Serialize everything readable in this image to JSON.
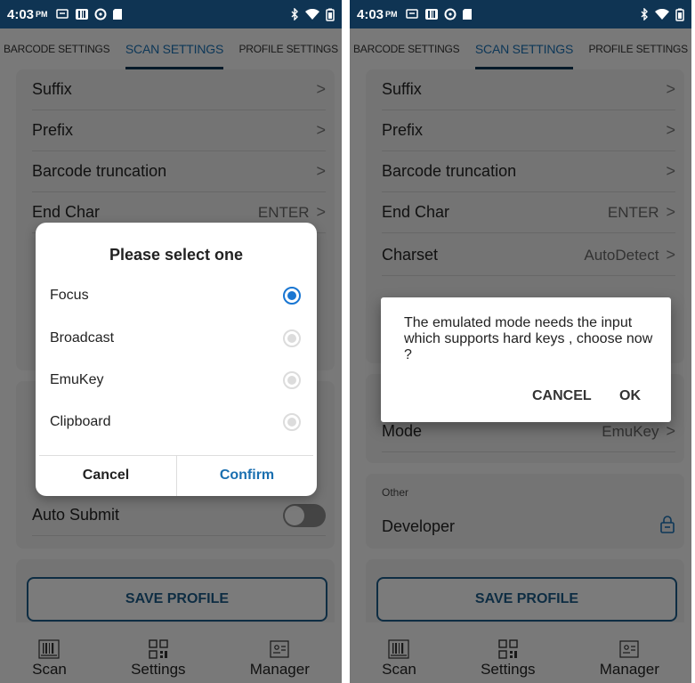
{
  "status": {
    "time": "4:03",
    "ampm": "PM"
  },
  "tabs": [
    "BARCODE SETTINGS",
    "SCAN SETTINGS",
    "PROFILE SETTINGS"
  ],
  "left": {
    "rows": [
      {
        "label": "Suffix",
        "value": "",
        "chevron": true
      },
      {
        "label": "Prefix",
        "value": "",
        "chevron": true
      },
      {
        "label": "Barcode truncation",
        "value": "",
        "chevron": true
      },
      {
        "label": "End Char",
        "value": "ENTER",
        "chevron": true
      }
    ],
    "auto_submit_label": "Auto Submit",
    "save_label": "SAVE PROFILE",
    "dialog": {
      "title": "Please select one",
      "options": [
        "Focus",
        "Broadcast",
        "EmuKey",
        "Clipboard"
      ],
      "selected": "Focus",
      "cancel": "Cancel",
      "confirm": "Confirm"
    }
  },
  "right": {
    "rows": [
      {
        "label": "Suffix",
        "value": "",
        "chevron": true
      },
      {
        "label": "Prefix",
        "value": "",
        "chevron": true
      },
      {
        "label": "Barcode truncation",
        "value": "",
        "chevron": true
      },
      {
        "label": "End Char",
        "value": "ENTER",
        "chevron": true
      },
      {
        "label": "Charset",
        "value": "AutoDetect",
        "chevron": true
      }
    ],
    "mode": {
      "label": "Mode",
      "value": "EmuKey"
    },
    "other_section": "Other",
    "developer_label": "Developer",
    "save_label": "SAVE PROFILE",
    "alert": {
      "message": "The emulated mode needs the input which supports hard keys , choose now ?",
      "cancel": "CANCEL",
      "ok": "OK"
    }
  },
  "nav": {
    "scan": "Scan",
    "settings": "Settings",
    "manager": "Manager"
  },
  "icons": {
    "chevron": "chevron-right-icon",
    "lock": "lock-icon"
  },
  "colors": {
    "statusbar": "#0f3453",
    "accent": "#1a6fb0",
    "radio_selected": "#1976d2",
    "save_border": "#1c5a86"
  }
}
